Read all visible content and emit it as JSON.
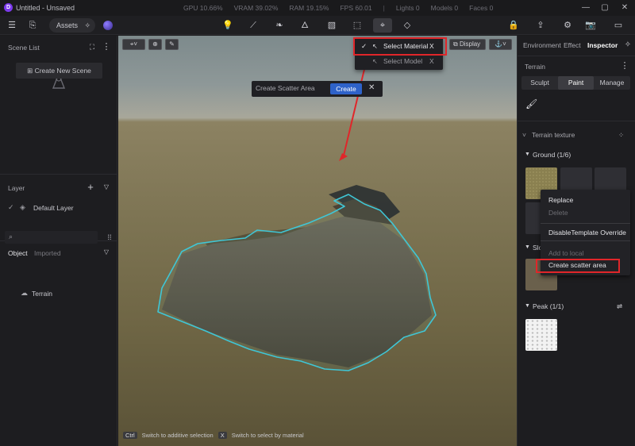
{
  "titlebar": {
    "logo": "D",
    "title": "Untitled - Unsaved",
    "stats": [
      "GPU 10.66%",
      "VRAM 39.02%",
      "RAM 19.15%",
      "FPS 60.01",
      "|",
      "Lights 0",
      "Models 0",
      "Faces 0"
    ],
    "window_buttons": [
      "—",
      "▢",
      "✕"
    ]
  },
  "toolbar": {
    "assets_label": "Assets",
    "assets_icon": "✧",
    "tool_icons": [
      "☰",
      "⎘",
      "💡",
      "⟋",
      "❧",
      "🜂",
      "▧",
      "⬚",
      "⌖",
      "◇"
    ],
    "right_icons": [
      "🔒",
      "⇪",
      "⚙",
      "📷",
      "🎬",
      "▭"
    ]
  },
  "left_panel": {
    "scene_list_title": "Scene List",
    "scene_icon": "⛶",
    "create_scene_label": "Create New Scene",
    "layer_title": "Layer",
    "layer_add": "+",
    "default_layer": "Default Layer",
    "object_tab": "Object",
    "imported_tab": "Imported",
    "search_placeholder": "",
    "terrain_item": "Terrain"
  },
  "viewport": {
    "vp_tool_labels": [
      "⌖˅",
      "⊕",
      "✎"
    ],
    "display_label": "Display",
    "display_icon": "⧉",
    "display_arrow": "⚓˅",
    "select_menu": {
      "check": "✓",
      "cursor": "↖",
      "select_material": "Select Material",
      "select_material_key": "X",
      "select_model": "Select Model",
      "select_model_key": "X"
    },
    "scatter_bar": {
      "placeholder": "Create Scatter Area",
      "create_label": "Create",
      "close_label": "✕"
    },
    "hint_ctrl": "Ctrl",
    "hint_ctrl_text": "Switch to additive selection",
    "hint_x": "X",
    "hint_x_text": "Switch to select by material"
  },
  "right_panel": {
    "tabs": [
      "Environment",
      "Effect",
      "Inspector"
    ],
    "section_title": "Terrain",
    "segments": [
      "Sculpt",
      "Paint",
      "Manage"
    ],
    "terrain_texture": "Terrain texture",
    "ground": "Ground (1/6)",
    "slope_prefix": "Slo",
    "peak": "Peak (1/1)",
    "context_menu": {
      "replace": "Replace",
      "delete": "Delete",
      "disable_template": "DisableTemplate Override",
      "add_local": "Add to local",
      "create_scatter": "Create scatter area"
    }
  },
  "colors": {
    "accent": "#2e62c9",
    "highlight": "#e0262a",
    "selection_outline": "#3fc6d6"
  }
}
